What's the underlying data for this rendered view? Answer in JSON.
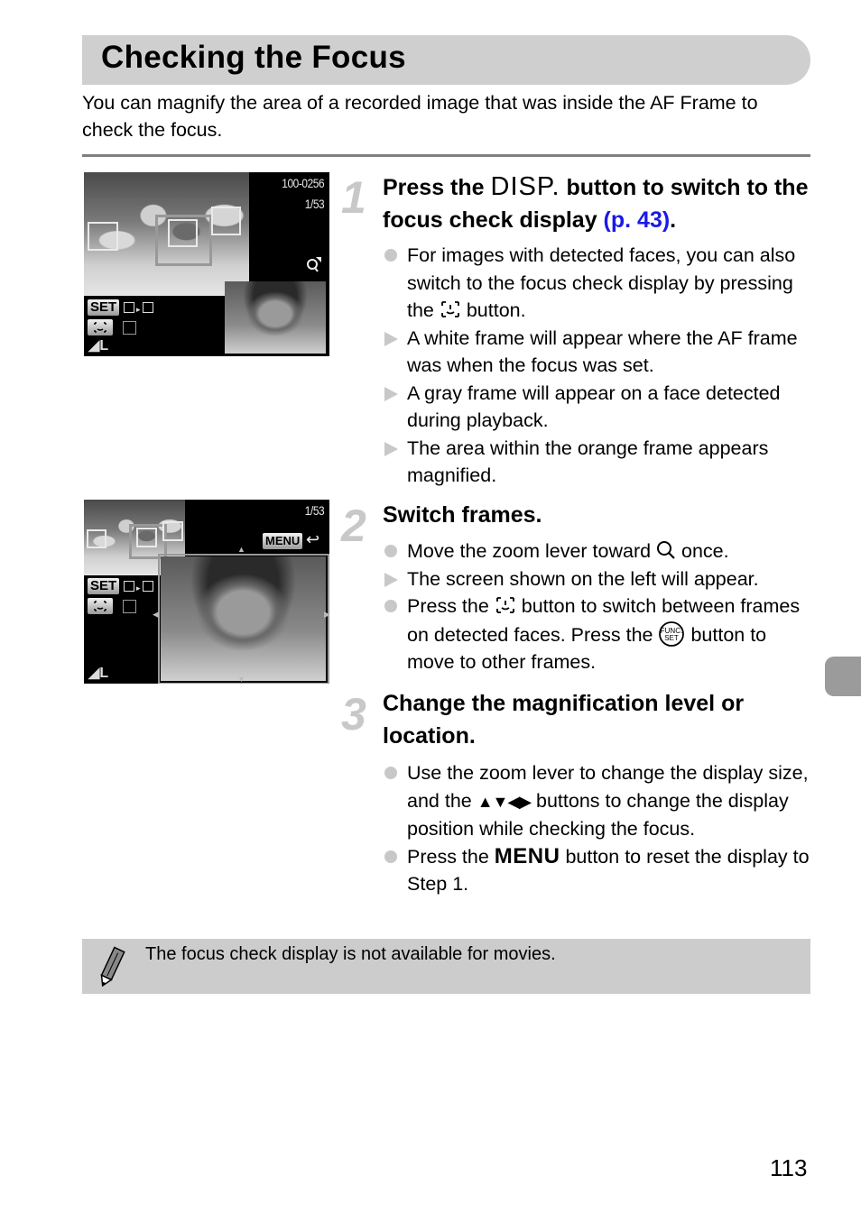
{
  "header": {
    "title": "Checking the Focus"
  },
  "intro": "You can magnify the area of a recorded image that was inside the AF Frame to check the focus.",
  "screens": [
    {
      "file_number": "100-0256",
      "image_count": "1/53",
      "set_label": "SET",
      "size_label": "L"
    },
    {
      "image_count": "1/53",
      "menu_label": "MENU",
      "set_label": "SET",
      "size_label": "L"
    }
  ],
  "steps": [
    {
      "number": "1",
      "heading_pre": "Press the ",
      "heading_button": "DISP.",
      "heading_post": " button to switch to the focus check display ",
      "heading_link": "(p. 43)",
      "heading_end": ".",
      "bullets": [
        {
          "marker": "dot",
          "pre": "For images with detected faces, you can also switch to the focus check display by pressing the ",
          "icon": "face-select-icon",
          "post": " button."
        },
        {
          "marker": "triangle",
          "text": "A white frame will appear where the AF frame was when the focus was set."
        },
        {
          "marker": "triangle",
          "text": "A gray frame will appear on a face detected during playback."
        },
        {
          "marker": "triangle",
          "text": "The area within the orange frame appears magnified."
        }
      ]
    },
    {
      "number": "2",
      "heading": "Switch frames.",
      "bullets": [
        {
          "marker": "dot",
          "pre": "Move the zoom lever toward ",
          "icon": "magnify-icon",
          "post": " once."
        },
        {
          "marker": "triangle",
          "text": "The screen shown on the left will appear."
        },
        {
          "marker": "dot",
          "pre": "Press the ",
          "icon": "face-select-icon",
          "mid": " button to switch between frames on detected faces. Press the ",
          "icon2": "func-set-icon",
          "post": " button to move to other frames."
        }
      ]
    },
    {
      "number": "3",
      "heading": "Change the magnification level or location.",
      "bullets": [
        {
          "marker": "dot",
          "pre": "Use the zoom lever to change the display size, and the ",
          "icon": "arrow-keys-icon",
          "post": " buttons to change the display position while checking the focus."
        },
        {
          "marker": "dot",
          "pre": "Press the ",
          "button": "MENU",
          "post": " button to reset the display to Step 1."
        }
      ]
    }
  ],
  "note": {
    "text": "The focus check display is not available for movies."
  },
  "page_number": "113",
  "colors": {
    "link": "#1a1ae6",
    "title_bar": "#cfcfcf",
    "note_bg": "#cccccc",
    "marker": "#c8c8c8",
    "side_tab": "#9b9b9b"
  }
}
